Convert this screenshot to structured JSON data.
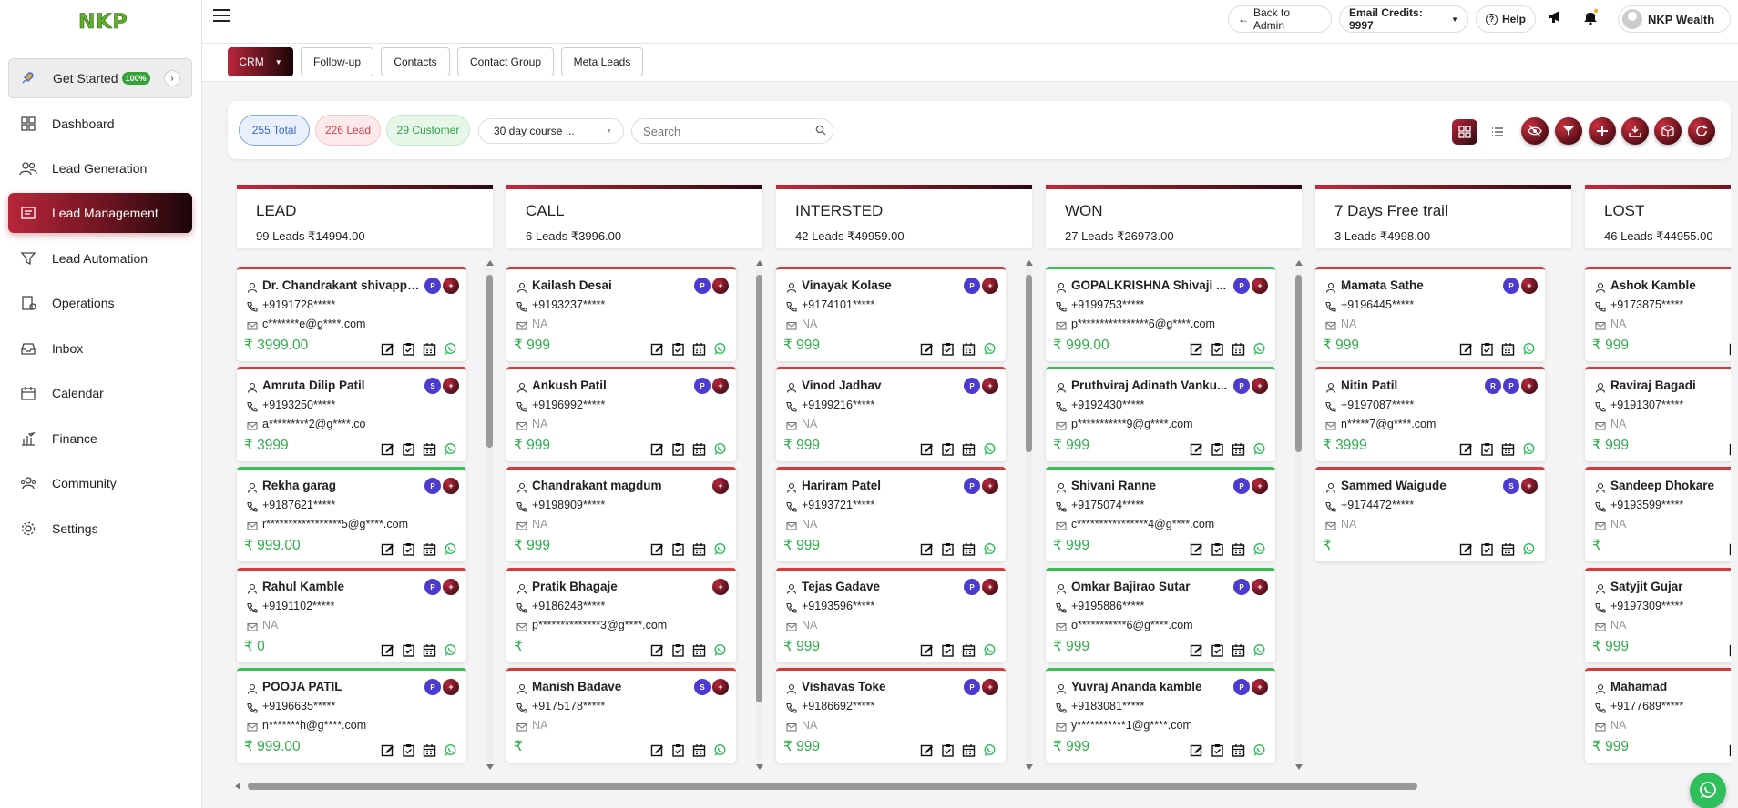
{
  "brand": {
    "logo": "NKP"
  },
  "sidebar": {
    "get_started": {
      "label": "Get Started",
      "badge": "100%"
    },
    "items": [
      {
        "label": "Dashboard",
        "icon": "dashboard-icon"
      },
      {
        "label": "Lead Generation",
        "icon": "users-icon"
      },
      {
        "label": "Lead Management",
        "icon": "lead-management-icon",
        "active": true
      },
      {
        "label": "Lead Automation",
        "icon": "funnel-icon"
      },
      {
        "label": "Operations",
        "icon": "operations-icon"
      },
      {
        "label": "Inbox",
        "icon": "inbox-icon"
      },
      {
        "label": "Calendar",
        "icon": "calendar-icon"
      },
      {
        "label": "Finance",
        "icon": "finance-icon"
      },
      {
        "label": "Community",
        "icon": "community-icon"
      },
      {
        "label": "Settings",
        "icon": "settings-icon"
      }
    ]
  },
  "topbar": {
    "back_to_admin": "Back to Admin",
    "email_credits": "Email Credits: 9997",
    "help": "Help",
    "profile_name": "NKP Wealth"
  },
  "tabs": [
    {
      "label": "CRM",
      "active": true
    },
    {
      "label": "Follow-up"
    },
    {
      "label": "Contacts"
    },
    {
      "label": "Contact Group"
    },
    {
      "label": "Meta Leads"
    }
  ],
  "filters": {
    "total": "255 Total",
    "lead": "226 Lead",
    "customer": "29 Customer",
    "course_select": "30 day course ...",
    "search_placeholder": "Search"
  },
  "colors": {
    "accent": "#b8263a",
    "amount_green": "#2fae4a",
    "whatsapp": "#2fbf5a"
  },
  "columns": [
    {
      "title": "LEAD",
      "summary": "99 Leads ₹14994.00",
      "cards": [
        {
          "name": "Dr. Chandrakant shivappa ...",
          "phone": "+9191728*****",
          "email": "c*******e@g****.com",
          "amount": "₹ 3999.00",
          "badges": [
            "P"
          ],
          "color": "red"
        },
        {
          "name": "Amruta Dilip Patil",
          "phone": "+9193250*****",
          "email": "a*********2@g****.co",
          "amount": "₹ 3999",
          "badges": [
            "S"
          ],
          "color": "red"
        },
        {
          "name": "Rekha garag",
          "phone": "+9187621*****",
          "email": "r*****************5@g****.com",
          "amount": "₹ 999.00",
          "badges": [
            "P"
          ],
          "color": "green"
        },
        {
          "name": "Rahul Kamble",
          "phone": "+9191102*****",
          "email": "NA",
          "amount": "₹ 0",
          "badges": [
            "P"
          ],
          "color": "red"
        },
        {
          "name": "POOJA PATIL",
          "phone": "+9196635*****",
          "email": "n*******h@g****.com",
          "amount": "₹ 999.00",
          "badges": [
            "P"
          ],
          "color": "green"
        }
      ]
    },
    {
      "title": "CALL",
      "summary": "6 Leads ₹3996.00",
      "cards": [
        {
          "name": "Kailash Desai",
          "phone": "+9193237*****",
          "email": "NA",
          "amount": "₹ 999",
          "badges": [
            "P"
          ],
          "color": "red"
        },
        {
          "name": "Ankush Patil",
          "phone": "+9196992*****",
          "email": "NA",
          "amount": "₹ 999",
          "badges": [
            "P"
          ],
          "color": "red"
        },
        {
          "name": "Chandrakant magdum",
          "phone": "+9198909*****",
          "email": "NA",
          "amount": "₹ 999",
          "badges": [],
          "color": "red"
        },
        {
          "name": "Pratik Bhagaje",
          "phone": "+9186248*****",
          "email": "p**************3@g****.com",
          "amount": "₹",
          "badges": [],
          "color": "red"
        },
        {
          "name": "Manish Badave",
          "phone": "+9175178*****",
          "email": "NA",
          "amount": "₹",
          "badges": [
            "S"
          ],
          "color": "red"
        }
      ]
    },
    {
      "title": "INTERSTED",
      "summary": "42 Leads ₹49959.00",
      "cards": [
        {
          "name": "Vinayak Kolase",
          "phone": "+9174101*****",
          "email": "NA",
          "amount": "₹ 999",
          "badges": [
            "P"
          ],
          "color": "red"
        },
        {
          "name": "Vinod Jadhav",
          "phone": "+9199216*****",
          "email": "NA",
          "amount": "₹ 999",
          "badges": [
            "P"
          ],
          "color": "red"
        },
        {
          "name": "Hariram Patel",
          "phone": "+9193721*****",
          "email": "NA",
          "amount": "₹ 999",
          "badges": [
            "P"
          ],
          "color": "red"
        },
        {
          "name": "Tejas Gadave",
          "phone": "+9193596*****",
          "email": "NA",
          "amount": "₹ 999",
          "badges": [
            "P"
          ],
          "color": "red"
        },
        {
          "name": "Vishavas Toke",
          "phone": "+9186692*****",
          "email": "NA",
          "amount": "₹ 999",
          "badges": [
            "P"
          ],
          "color": "red"
        }
      ]
    },
    {
      "title": "WON",
      "summary": "27 Leads ₹26973.00",
      "cards": [
        {
          "name": "GOPALKRISHNA Shivaji ...",
          "phone": "+9199753*****",
          "email": "p****************6@g****.com",
          "amount": "₹ 999.00",
          "badges": [
            "P"
          ],
          "color": "green"
        },
        {
          "name": "Pruthviraj Adinath Vanku...",
          "phone": "+9192430*****",
          "email": "p***********9@g****.com",
          "amount": "₹ 999",
          "badges": [
            "P"
          ],
          "color": "green"
        },
        {
          "name": "Shivani Ranne",
          "phone": "+9175074*****",
          "email": "c****************4@g****.com",
          "amount": "₹ 999",
          "badges": [
            "P"
          ],
          "color": "green"
        },
        {
          "name": "Omkar Bajirao Sutar",
          "phone": "+9195886*****",
          "email": "o***********6@g****.com",
          "amount": "₹ 999",
          "badges": [
            "P"
          ],
          "color": "green"
        },
        {
          "name": "Yuvraj Ananda kamble",
          "phone": "+9183081*****",
          "email": "y***********1@g****.com",
          "amount": "₹ 999",
          "badges": [
            "P"
          ],
          "color": "green"
        }
      ]
    },
    {
      "title": "7 Days Free trail",
      "summary": "3 Leads ₹4998.00",
      "cards": [
        {
          "name": "Mamata Sathe",
          "phone": "+9196445*****",
          "email": "NA",
          "amount": "₹ 999",
          "badges": [
            "P"
          ],
          "color": "red"
        },
        {
          "name": "Nitin Patil",
          "phone": "+9197087*****",
          "email": "n*****7@g****.com",
          "amount": "₹ 3999",
          "badges": [
            "R",
            "P"
          ],
          "color": "red"
        },
        {
          "name": "Sammed Waigude",
          "phone": "+9174472*****",
          "email": "NA",
          "amount": "₹",
          "badges": [
            "S"
          ],
          "color": "red"
        }
      ]
    },
    {
      "title": "LOST",
      "summary": "46 Leads ₹44955.00",
      "cards": [
        {
          "name": "Ashok Kamble",
          "phone": "+9173875*****",
          "email": "NA",
          "amount": "₹ 999",
          "badges": [],
          "color": "red"
        },
        {
          "name": "Raviraj Bagadi",
          "phone": "+9191307*****",
          "email": "NA",
          "amount": "₹ 999",
          "badges": [],
          "color": "red"
        },
        {
          "name": "Sandeep Dhokare",
          "phone": "+9193599*****",
          "email": "NA",
          "amount": "₹",
          "badges": [],
          "color": "red"
        },
        {
          "name": "Satyjit Gujar",
          "phone": "+9197309*****",
          "email": "NA",
          "amount": "₹ 999",
          "badges": [],
          "color": "red"
        },
        {
          "name": "Mahamad",
          "phone": "+9177689*****",
          "email": "NA",
          "amount": "₹ 999",
          "badges": [],
          "color": "red"
        }
      ]
    }
  ]
}
